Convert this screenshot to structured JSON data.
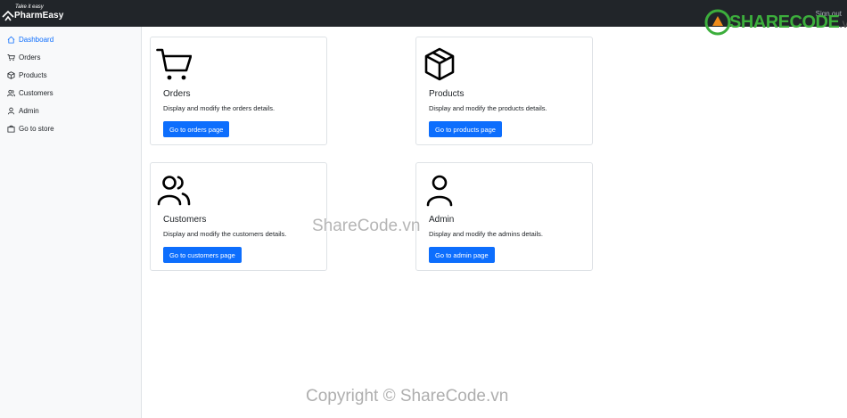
{
  "header": {
    "tagline": "Take it easy",
    "brand": "PharmEasy",
    "signout_label": "Sign out"
  },
  "sidebar": {
    "items": [
      {
        "label": "Dashboard",
        "icon": "home-icon",
        "active": true
      },
      {
        "label": "Orders",
        "icon": "cart-icon",
        "active": false
      },
      {
        "label": "Products",
        "icon": "box-icon",
        "active": false
      },
      {
        "label": "Customers",
        "icon": "users-icon",
        "active": false
      },
      {
        "label": "Admin",
        "icon": "user-icon",
        "active": false
      },
      {
        "label": "Go to store",
        "icon": "store-icon",
        "active": false
      }
    ]
  },
  "cards": [
    {
      "title": "Orders",
      "text": "Display and modify the orders details.",
      "button": "Go to orders page",
      "icon": "cart-icon"
    },
    {
      "title": "Products",
      "text": "Display and modify the products details.",
      "button": "Go to products page",
      "icon": "box-icon"
    },
    {
      "title": "Customers",
      "text": "Display and modify the customers details.",
      "button": "Go to customers page",
      "icon": "users-icon"
    },
    {
      "title": "Admin",
      "text": "Display and modify the admins details.",
      "button": "Go to admin page",
      "icon": "user-icon"
    }
  ],
  "watermark": {
    "logo_main": "SHARECODE",
    "logo_suffix": ".vn",
    "center": "ShareCode.vn",
    "copyright": "Copyright © ShareCode.vn"
  },
  "colors": {
    "accent": "#0d6efd",
    "topbar": "#212529",
    "sidebar_bg": "#f8f9fa"
  }
}
